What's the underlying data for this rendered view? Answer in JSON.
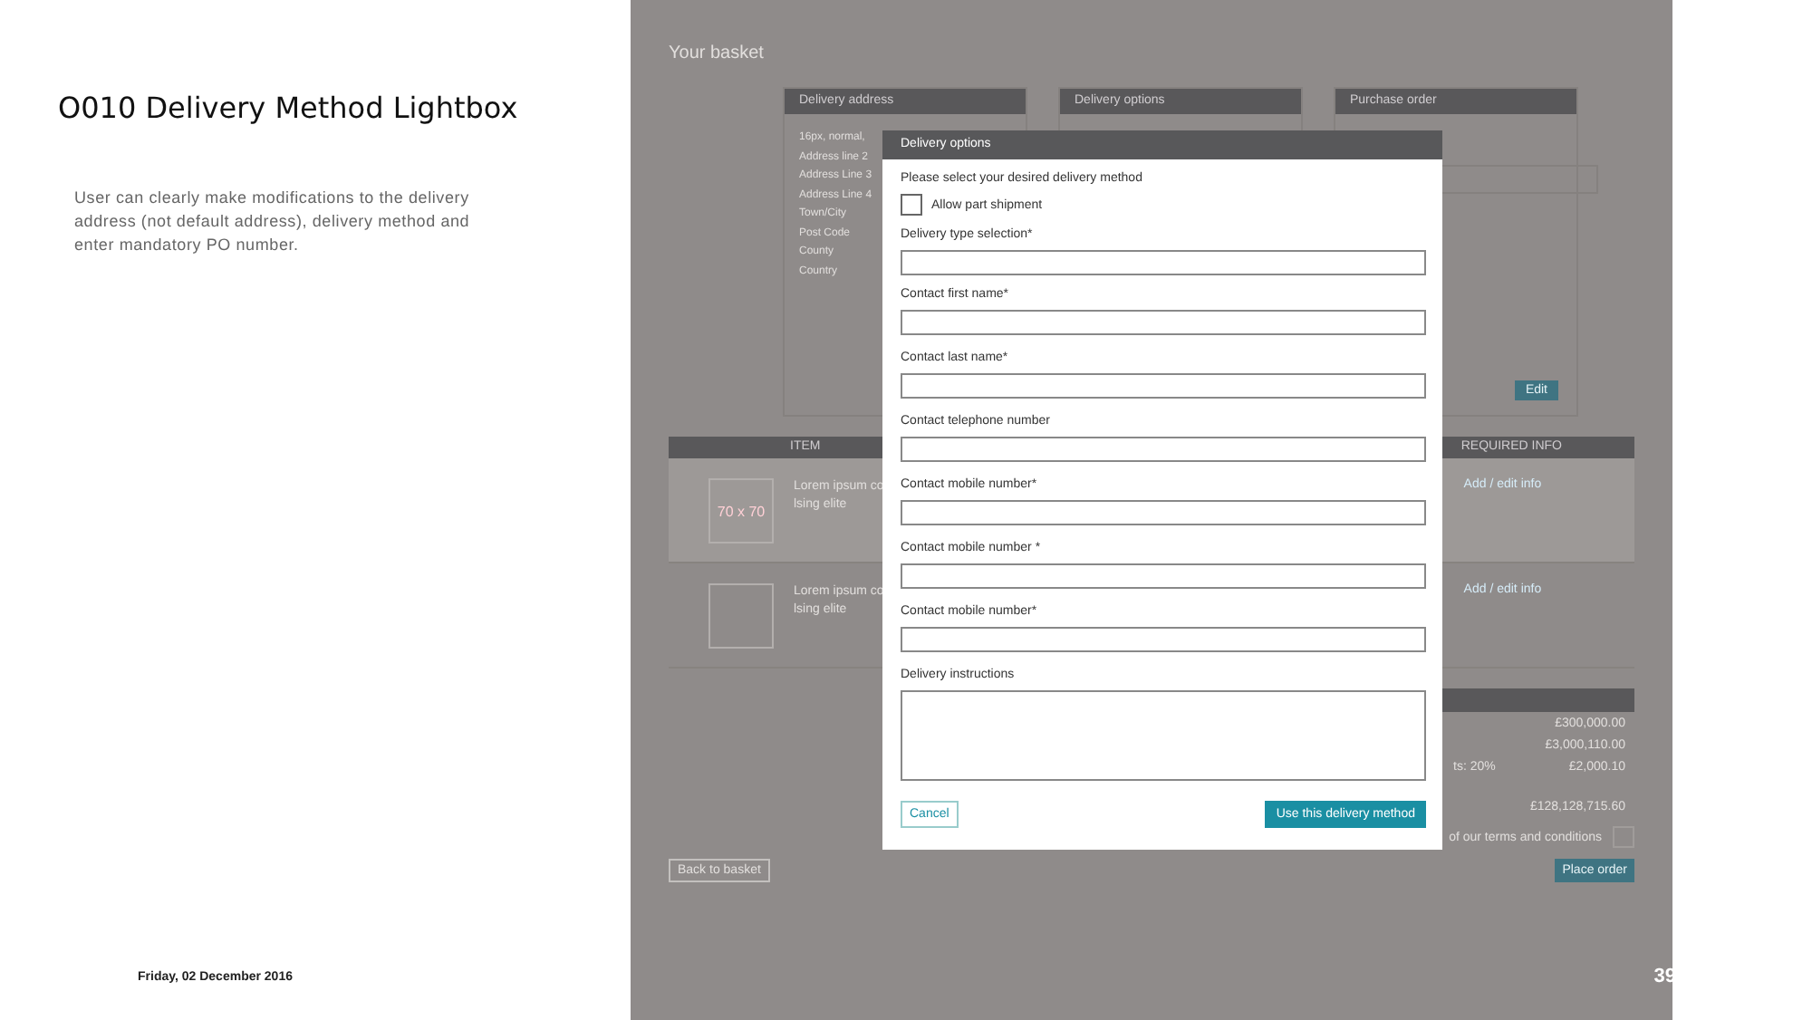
{
  "slide": {
    "title": "O010 Delivery Method Lightbox",
    "description": "User can clearly make modifications to the delivery address (not default address), delivery method and enter mandatory PO number.",
    "date": "Friday, 02 December 2016",
    "page_number": "39"
  },
  "basket": {
    "title": "Your basket",
    "panels": [
      {
        "title": "Delivery address",
        "kind": "address",
        "lines": [
          "16px, normal,",
          "Address line 2",
          "Address Line 3",
          "Address Line 4",
          "Town/City",
          "Post Code",
          "County",
          "Country"
        ]
      },
      {
        "title": "Delivery options",
        "kind": "empty"
      },
      {
        "title": "Purchase order",
        "kind": "field",
        "button": "Edit"
      }
    ],
    "table": {
      "columns": [
        "ITEM",
        "REQUIRED INFO"
      ],
      "rows": [
        {
          "thumbnail": "70 x 70",
          "description": "Lorem ipsum co\nlsing elite",
          "link": "Add / edit info",
          "highlighted": true
        },
        {
          "description": "Lorem ipsum co\nlsing elite",
          "link": "Add / edit info",
          "highlighted": false
        }
      ]
    },
    "totals": [
      {
        "value": "£300,000.00"
      },
      {
        "value": "£3,000,110.00"
      },
      {
        "label": "ts: 20%",
        "value": "£2,000.10"
      },
      {
        "value": "£128,128,715.60",
        "kind": "total"
      }
    ],
    "terms": {
      "text": "of our terms and conditions",
      "checked": false
    },
    "back_button": "Back to basket",
    "place_order_button": "Place order"
  },
  "modal": {
    "title": "Delivery options",
    "prompt": "Please select your desired delivery method",
    "checkbox": {
      "label": "Allow part shipment",
      "checked": false
    },
    "fields": [
      {
        "label": "Delivery type selection*",
        "kind": "input"
      },
      {
        "label": "Contact first name*",
        "kind": "input"
      },
      {
        "label": "Contact last name*",
        "kind": "input"
      },
      {
        "label": "Contact telephone number",
        "kind": "input"
      },
      {
        "label": "Contact mobile number*",
        "kind": "input"
      },
      {
        "label": "Contact mobile number *",
        "kind": "input"
      },
      {
        "label": "Contact mobile number*",
        "kind": "input"
      },
      {
        "label": "Delivery instructions",
        "kind": "textarea"
      }
    ],
    "buttons": [
      {
        "label": "Cancel",
        "kind": "secondary"
      },
      {
        "label": "Use this delivery method",
        "kind": "primary"
      }
    ]
  }
}
